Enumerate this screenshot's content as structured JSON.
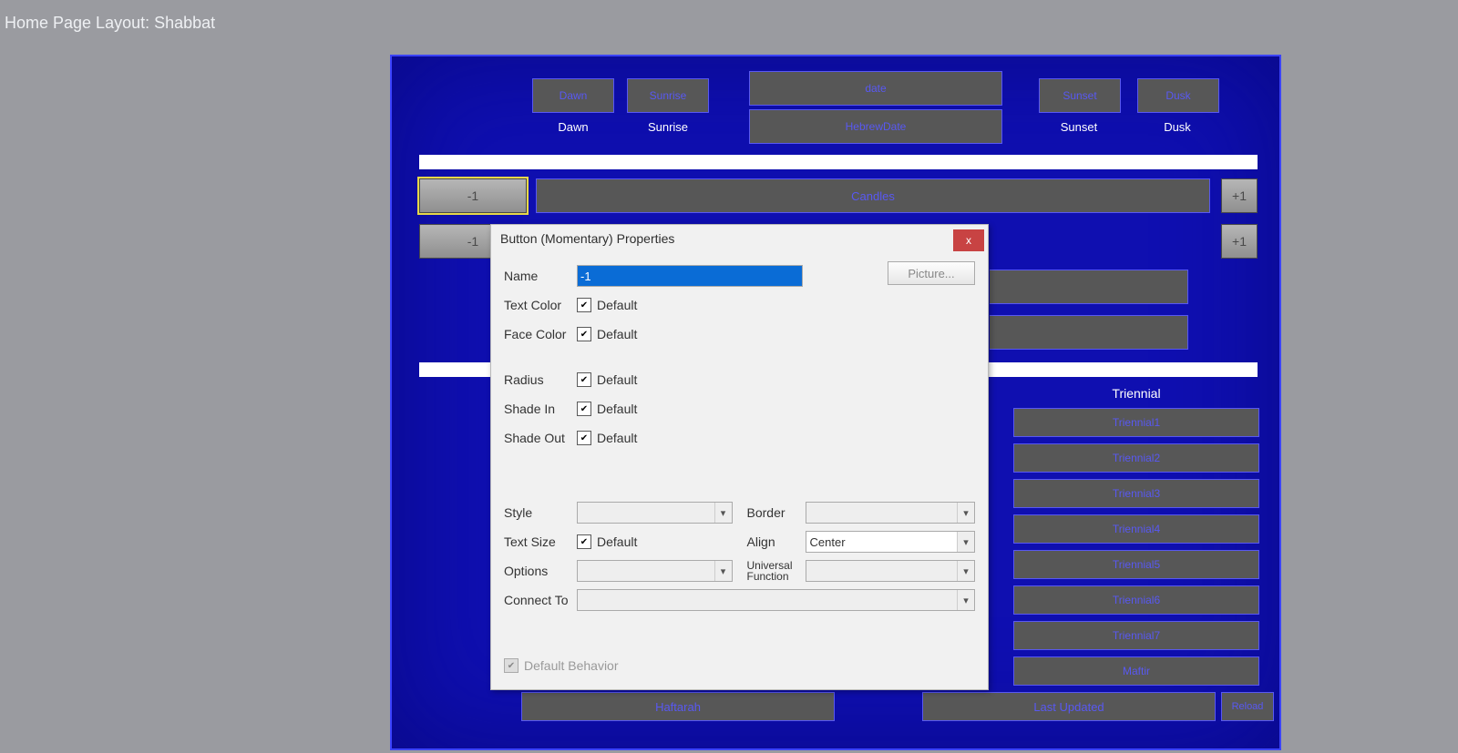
{
  "page_title": "Home Page Layout: Shabbat",
  "top_row": {
    "dawn_btn": "Dawn",
    "dawn_lbl": "Dawn",
    "sunrise_btn": "Sunrise",
    "sunrise_lbl": "Sunrise",
    "date_btn": "date",
    "hebrew_btn": "HebrewDate",
    "sunset_btn": "Sunset",
    "sunset_lbl": "Sunset",
    "dusk_btn": "Dusk",
    "dusk_lbl": "Dusk"
  },
  "steel": {
    "minus": "-1",
    "plus": "+1",
    "minus2": "-1",
    "plus2": "+1"
  },
  "wide": {
    "candles": "Candles",
    "haftarah": "Haftarah",
    "last_updated": "Last Updated",
    "reload": "Reload"
  },
  "triennial": {
    "header": "Triennial",
    "items": [
      "Triennial1",
      "Triennial2",
      "Triennial3",
      "Triennial4",
      "Triennial5",
      "Triennial6",
      "Triennial7",
      "Maftir"
    ]
  },
  "dialog": {
    "title": "Button (Momentary) Properties",
    "close": "x",
    "name_label": "Name",
    "name_value": "-1",
    "picture_btn": "Picture...",
    "text_color": "Text Color",
    "face_color": "Face Color",
    "radius": "Radius",
    "shade_in": "Shade In",
    "shade_out": "Shade Out",
    "default_txt": "Default",
    "style": "Style",
    "text_size": "Text Size",
    "options": "Options",
    "border": "Border",
    "align": "Align",
    "align_value": "Center",
    "universal": "Universal Function",
    "connect_to": "Connect To",
    "default_behavior": "Default Behavior"
  }
}
